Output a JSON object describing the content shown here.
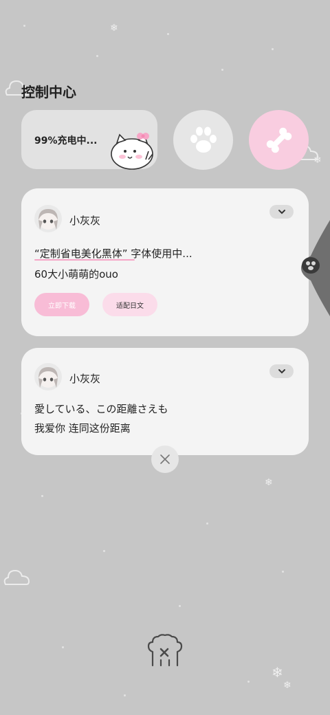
{
  "control_center": {
    "title": "控制中心",
    "battery_text": "99%充电中..."
  },
  "notifications": [
    {
      "username": "小灰灰",
      "line1": "“定制省电美化黑体” 字体使用中...",
      "line2": "60大小萌萌的ouo",
      "actions": [
        "立即下载",
        "适配日文"
      ]
    },
    {
      "username": "小灰灰",
      "line1": "愛している、この距離さえも",
      "line2": "我爱你 连同这份距离"
    }
  ],
  "colors": {
    "background": "#c6c6c6",
    "card": "#f4f4f4",
    "accent_pink": "#f9cde0",
    "pill_pink": "#f8bcd6"
  },
  "icons": [
    "paw-icon",
    "bone-icon",
    "chevron-down-icon",
    "close-icon",
    "pig-sticker",
    "cloud-icon",
    "snowflake-icon"
  ]
}
